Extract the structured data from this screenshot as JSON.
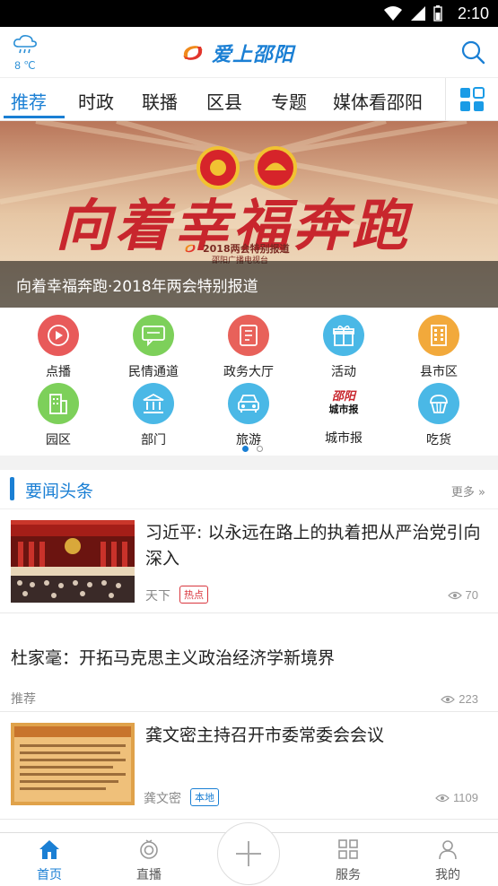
{
  "status_bar": {
    "time": "2:10"
  },
  "header": {
    "weather": {
      "icon": "cloud-rain-icon",
      "temp": "8 ℃"
    },
    "logo_text": "爱上邵阳"
  },
  "tabs": [
    {
      "label": "推荐",
      "active": true
    },
    {
      "label": "时政"
    },
    {
      "label": "联播"
    },
    {
      "label": "区县"
    },
    {
      "label": "专题"
    },
    {
      "label": "媒体看邵阳"
    }
  ],
  "banner": {
    "headline_art": "向着幸福奔跑",
    "sub_art": "2018两会特别报道",
    "sub_art2": "邵阳广播电视台",
    "caption": "向着幸福奔跑·2018年两会特别报道"
  },
  "quick_grid": [
    {
      "label": "点播",
      "color": "#e85a5a",
      "icon": "play-circle-icon"
    },
    {
      "label": "民情通道",
      "color": "#7dd05a",
      "icon": "chat-icon"
    },
    {
      "label": "政务大厅",
      "color": "#e8615a",
      "icon": "document-icon"
    },
    {
      "label": "活动",
      "color": "#4ab8e6",
      "icon": "gift-icon"
    },
    {
      "label": "县市区",
      "color": "#f2a93b",
      "icon": "building-icon"
    },
    {
      "label": "园区",
      "color": "#7dd05a",
      "icon": "office-icon"
    },
    {
      "label": "部门",
      "color": "#4ab8e6",
      "icon": "bank-icon"
    },
    {
      "label": "旅游",
      "color": "#4ab8e6",
      "icon": "car-icon"
    },
    {
      "label": "城市报",
      "color": "#ffffff",
      "icon": "newspaper-logo-icon",
      "logo_text": "邵阳",
      "logo_sub": "城市报"
    },
    {
      "label": "吃货",
      "color": "#4ab8e6",
      "icon": "cupcake-icon"
    }
  ],
  "section": {
    "title": "要闻头条",
    "more": "更多 »"
  },
  "news": [
    {
      "title": "习近平: 以永远在路上的执着把从严治党引向深入",
      "source": "天下",
      "tag": "热点",
      "tag_color": "#d9363e",
      "views": "70"
    },
    {
      "title": "杜家毫：开拓马克思主义政治经济学新境界",
      "source": "推荐",
      "views": "223"
    },
    {
      "title": "龚文密主持召开市委常委会会议",
      "source": "龚文密",
      "tag": "本地",
      "tag_color": "#1a7fd4",
      "views": "1109"
    }
  ],
  "bottom_nav": [
    {
      "label": "首页",
      "icon": "home-icon",
      "active": true
    },
    {
      "label": "直播",
      "icon": "live-icon"
    },
    {
      "label": "",
      "icon": "plus-icon"
    },
    {
      "label": "服务",
      "icon": "grid-icon"
    },
    {
      "label": "我的",
      "icon": "user-icon"
    }
  ],
  "colors": {
    "accent": "#1a7fd4",
    "banner_red": "#c8262d"
  }
}
